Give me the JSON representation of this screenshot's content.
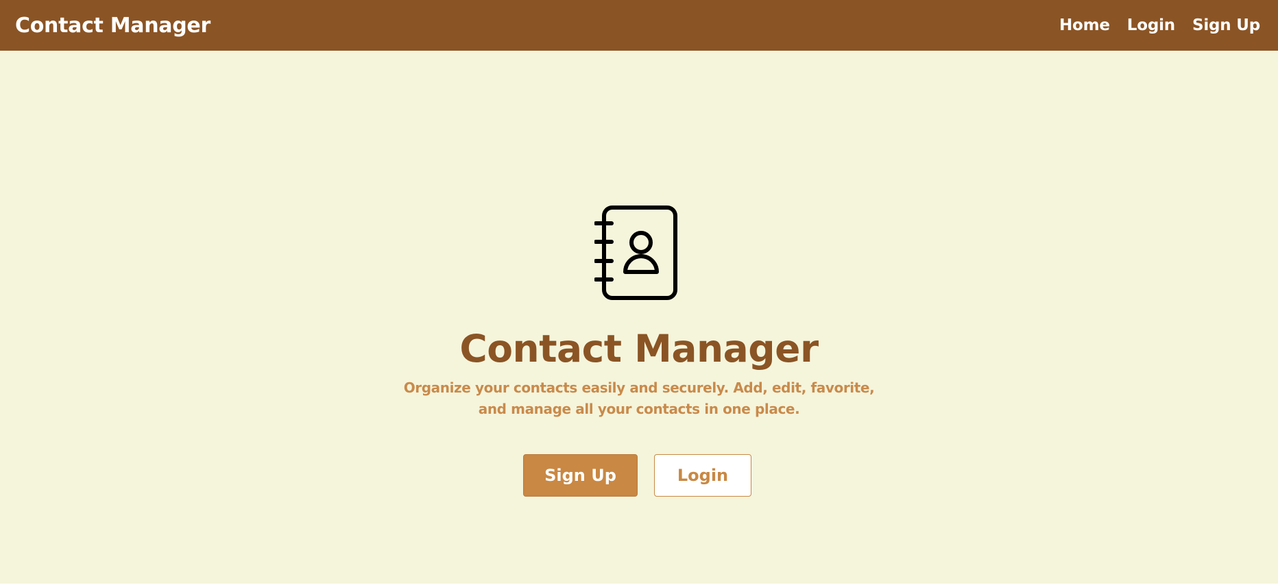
{
  "navbar": {
    "brand": "Contact Manager",
    "links": [
      {
        "label": "Home"
      },
      {
        "label": "Login"
      },
      {
        "label": "Sign Up"
      }
    ]
  },
  "hero": {
    "icon": "contact-book-icon",
    "title": "Contact Manager",
    "subtitle": "Organize your contacts easily and securely. Add, edit, favorite, and manage all your contacts in one place.",
    "buttons": {
      "signup_label": "Sign Up",
      "login_label": "Login"
    }
  },
  "colors": {
    "navbar_bg": "#8b5424",
    "page_bg": "#f5f5dc",
    "title": "#8b5424",
    "accent": "#c98843"
  }
}
